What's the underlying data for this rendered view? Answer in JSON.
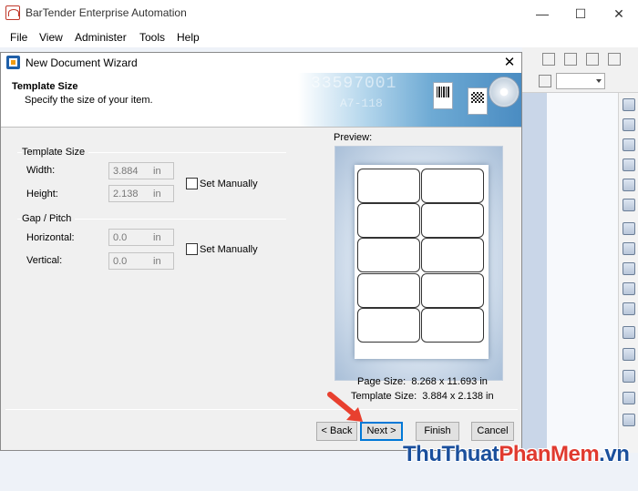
{
  "app": {
    "title": "BarTender Enterprise Automation",
    "menu": [
      "File",
      "View",
      "Administer",
      "Tools",
      "Help"
    ]
  },
  "dialog": {
    "title": "New Document Wizard",
    "header": {
      "title": "Template Size",
      "subtitle": "Specify the size of your item.",
      "banner_text_1": "33597001",
      "banner_text_2": "A7-118"
    },
    "template_size": {
      "group_label": "Template Size",
      "width_label": "Width:",
      "width_value": "3.884",
      "width_unit": "in",
      "height_label": "Height:",
      "height_value": "2.138",
      "height_unit": "in",
      "set_manually_label": "Set Manually",
      "set_manually_checked": false
    },
    "gap_pitch": {
      "group_label": "Gap / Pitch",
      "horizontal_label": "Horizontal:",
      "horizontal_value": "0.0",
      "horizontal_unit": "in",
      "vertical_label": "Vertical:",
      "vertical_value": "0.0",
      "vertical_unit": "in",
      "set_manually_label": "Set Manually",
      "set_manually_checked": false
    },
    "preview": {
      "label": "Preview:",
      "page_size_label": "Page Size:",
      "page_size_value": "8.268 x 11.693 in",
      "template_size_label": "Template Size:",
      "template_size_value": "3.884 x 2.138 in",
      "rows": 5,
      "columns": 2
    },
    "buttons": {
      "back": "< Back",
      "next": "Next  >",
      "finish": "Finish",
      "cancel": "Cancel"
    }
  },
  "watermark": {
    "part1": "ThuThuat",
    "part2": "PhanMem",
    "part3": ".vn"
  },
  "colors": {
    "accent": "#0078d7",
    "arrow": "#e8402f",
    "watermark_blue": "#1a4f9c",
    "watermark_red": "#e03a2f"
  }
}
